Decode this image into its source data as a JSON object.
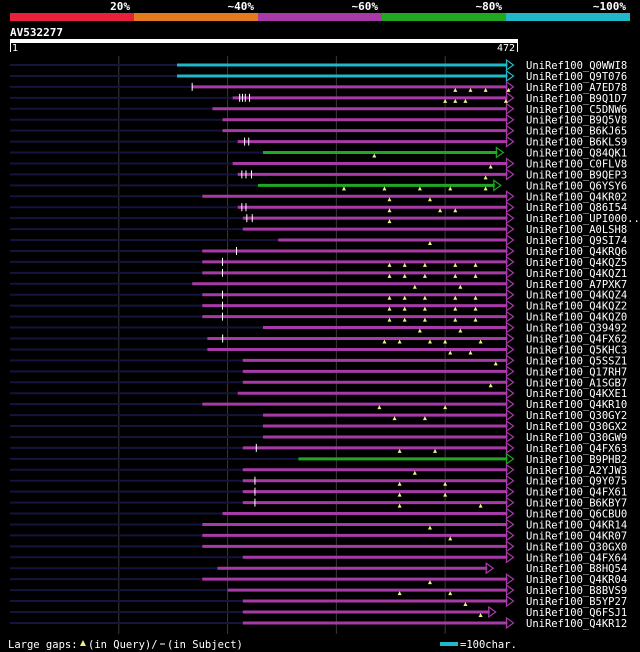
{
  "chart_data": {
    "type": "alignment-overview",
    "query": {
      "name": "AV532277",
      "start": "1",
      "end": "472"
    },
    "identity_legend": [
      {
        "label": "20%",
        "color": "#e8213a"
      },
      {
        "label": "~40%",
        "color": "#e87a1e"
      },
      {
        "label": "~60%",
        "color": "#a83aa8"
      },
      {
        "label": "~80%",
        "color": "#20a820"
      },
      {
        "label": "~100%",
        "color": "#20b8c8"
      }
    ],
    "hits": [
      {
        "name": "UniRef100_Q0WWI8",
        "from": 0.08,
        "to": 0.995,
        "identity": "~100%",
        "inserts": [],
        "gaps": []
      },
      {
        "name": "UniRef100_Q9T076",
        "from": 0.08,
        "to": 0.995,
        "identity": "~100%",
        "inserts": [],
        "gaps": []
      },
      {
        "name": "UniRef100_A7ED78",
        "from": 0.0,
        "to": 0.995,
        "identity": "~60%",
        "inserts": [
          0.88,
          0.91,
          0.94,
          0.985
        ],
        "gaps": [
          0.0
        ]
      },
      {
        "name": "UniRef100_B9Q1D7",
        "from": 0.0,
        "to": 0.995,
        "identity": "~60%",
        "inserts": [
          0.86,
          0.88,
          0.9,
          0.98
        ],
        "gaps": [
          0.05,
          0.07,
          0.09,
          0.12
        ]
      },
      {
        "name": "UniRef100_C5DNW6",
        "from": 0.0,
        "to": 0.995,
        "identity": "~60%",
        "inserts": [],
        "gaps": []
      },
      {
        "name": "UniRef100_B9Q5V8",
        "from": 0.0,
        "to": 0.995,
        "identity": "~60%",
        "inserts": [],
        "gaps": []
      },
      {
        "name": "UniRef100_B6KJ65",
        "from": 0.0,
        "to": 0.995,
        "identity": "~60%",
        "inserts": [],
        "gaps": []
      },
      {
        "name": "UniRef100_B6KLS9",
        "from": 0.0,
        "to": 0.995,
        "identity": "~60%",
        "inserts": [],
        "gaps": [
          0.05,
          0.08
        ]
      },
      {
        "name": "UniRef100_Q84QK1",
        "from": 0.0,
        "to": 0.975,
        "identity": "~80%",
        "inserts": [
          0.72
        ],
        "gaps": []
      },
      {
        "name": "UniRef100_C0FLV8",
        "from": 0.0,
        "to": 0.995,
        "identity": "~60%",
        "inserts": [
          0.95
        ],
        "gaps": []
      },
      {
        "name": "UniRef100_B9QEP3",
        "from": 0.0,
        "to": 0.995,
        "identity": "~60%",
        "inserts": [
          0.94
        ],
        "gaps": [
          0.03,
          0.06,
          0.1
        ]
      },
      {
        "name": "UniRef100_Q6YSY6",
        "from": 0.0,
        "to": 0.97,
        "identity": "~80%",
        "inserts": [
          0.66,
          0.74,
          0.81,
          0.87,
          0.94
        ],
        "gaps": []
      },
      {
        "name": "UniRef100_Q4KR02",
        "from": 0.0,
        "to": 0.995,
        "identity": "~60%",
        "inserts": [
          0.75,
          0.83
        ],
        "gaps": []
      },
      {
        "name": "UniRef100_Q86I54",
        "from": 0.0,
        "to": 0.995,
        "identity": "~60%",
        "inserts": [
          0.75,
          0.85,
          0.88
        ],
        "gaps": [
          0.03,
          0.06
        ]
      },
      {
        "name": "UniRef100_UPI000..",
        "from": 0.0,
        "to": 0.995,
        "identity": "~60%",
        "inserts": [
          0.75
        ],
        "gaps": [
          0.03,
          0.07
        ]
      },
      {
        "name": "UniRef100_A0LSH8",
        "from": 0.0,
        "to": 0.995,
        "identity": "~60%",
        "inserts": [],
        "gaps": []
      },
      {
        "name": "UniRef100_Q9SI74",
        "from": 0.0,
        "to": 0.995,
        "identity": "~60%",
        "inserts": [
          0.83
        ],
        "gaps": []
      },
      {
        "name": "UniRef100_Q4KRQ6",
        "from": 0.0,
        "to": 0.995,
        "identity": "~60%",
        "inserts": [],
        "gaps": [
          0.22
        ]
      },
      {
        "name": "UniRef100_Q4KQZ5",
        "from": 0.0,
        "to": 0.995,
        "identity": "~60%",
        "inserts": [
          0.75,
          0.78,
          0.82,
          0.88,
          0.92
        ],
        "gaps": [
          0.13
        ]
      },
      {
        "name": "UniRef100_Q4KQZ1",
        "from": 0.0,
        "to": 0.995,
        "identity": "~60%",
        "inserts": [
          0.75,
          0.78,
          0.82,
          0.88,
          0.92
        ],
        "gaps": [
          0.13
        ]
      },
      {
        "name": "UniRef100_A7PXK7",
        "from": 0.0,
        "to": 0.995,
        "identity": "~60%",
        "inserts": [
          0.8,
          0.89
        ],
        "gaps": []
      },
      {
        "name": "UniRef100_Q4KQZ4",
        "from": 0.0,
        "to": 0.995,
        "identity": "~60%",
        "inserts": [
          0.75,
          0.78,
          0.82,
          0.88,
          0.92
        ],
        "gaps": [
          0.13
        ]
      },
      {
        "name": "UniRef100_Q4KQZ2",
        "from": 0.0,
        "to": 0.995,
        "identity": "~60%",
        "inserts": [
          0.75,
          0.78,
          0.82,
          0.88,
          0.92
        ],
        "gaps": [
          0.13
        ]
      },
      {
        "name": "UniRef100_Q4KQZ0",
        "from": 0.0,
        "to": 0.995,
        "identity": "~60%",
        "inserts": [
          0.75,
          0.78,
          0.82,
          0.88,
          0.92
        ],
        "gaps": [
          0.13
        ]
      },
      {
        "name": "UniRef100_Q39492",
        "from": 0.0,
        "to": 0.995,
        "identity": "~60%",
        "inserts": [
          0.81,
          0.89
        ],
        "gaps": []
      },
      {
        "name": "UniRef100_Q4FX62",
        "from": 0.0,
        "to": 0.995,
        "identity": "~60%",
        "inserts": [
          0.74,
          0.77,
          0.83,
          0.86,
          0.93
        ],
        "gaps": [
          0.1
        ]
      },
      {
        "name": "UniRef100_Q5KHC3",
        "from": 0.0,
        "to": 0.995,
        "identity": "~60%",
        "inserts": [
          0.87,
          0.91
        ],
        "gaps": []
      },
      {
        "name": "UniRef100_Q5SSZ1",
        "from": 0.0,
        "to": 0.995,
        "identity": "~60%",
        "inserts": [
          0.96
        ],
        "gaps": []
      },
      {
        "name": "UniRef100_Q17RH7",
        "from": 0.0,
        "to": 0.995,
        "identity": "~60%",
        "inserts": [],
        "gaps": []
      },
      {
        "name": "UniRef100_A1SGB7",
        "from": 0.0,
        "to": 0.995,
        "identity": "~60%",
        "inserts": [
          0.95
        ],
        "gaps": []
      },
      {
        "name": "UniRef100_Q4KXE1",
        "from": 0.0,
        "to": 0.995,
        "identity": "~60%",
        "inserts": [],
        "gaps": []
      },
      {
        "name": "UniRef100_Q4KR10",
        "from": 0.0,
        "to": 0.995,
        "identity": "~60%",
        "inserts": [
          0.73,
          0.86
        ],
        "gaps": []
      },
      {
        "name": "UniRef100_Q30GY2",
        "from": 0.0,
        "to": 0.995,
        "identity": "~60%",
        "inserts": [
          0.76,
          0.82
        ],
        "gaps": []
      },
      {
        "name": "UniRef100_Q30GX2",
        "from": 0.0,
        "to": 0.995,
        "identity": "~60%",
        "inserts": [],
        "gaps": []
      },
      {
        "name": "UniRef100_Q30GW9",
        "from": 0.0,
        "to": 0.995,
        "identity": "~60%",
        "inserts": [],
        "gaps": []
      },
      {
        "name": "UniRef100_Q4FX63",
        "from": 0.0,
        "to": 0.995,
        "identity": "~60%",
        "inserts": [
          0.77,
          0.84
        ],
        "gaps": [
          0.1
        ]
      },
      {
        "name": "UniRef100_B9PHB2",
        "from": 0.0,
        "to": 0.995,
        "identity": "~80%",
        "inserts": [],
        "gaps": []
      },
      {
        "name": "UniRef100_A2YJW3",
        "from": 0.0,
        "to": 0.995,
        "identity": "~60%",
        "inserts": [
          0.8
        ],
        "gaps": []
      },
      {
        "name": "UniRef100_Q9Y075",
        "from": 0.0,
        "to": 0.995,
        "identity": "~60%",
        "inserts": [
          0.77,
          0.86
        ],
        "gaps": [
          0.09
        ]
      },
      {
        "name": "UniRef100_Q4FX61",
        "from": 0.0,
        "to": 0.995,
        "identity": "~60%",
        "inserts": [
          0.77,
          0.86
        ],
        "gaps": [
          0.09
        ]
      },
      {
        "name": "UniRef100_B6KBY7",
        "from": 0.0,
        "to": 0.995,
        "identity": "~60%",
        "inserts": [
          0.77,
          0.93
        ],
        "gaps": [
          0.09
        ]
      },
      {
        "name": "UniRef100_Q6CBU0",
        "from": 0.0,
        "to": 0.995,
        "identity": "~60%",
        "inserts": [],
        "gaps": []
      },
      {
        "name": "UniRef100_Q4KR14",
        "from": 0.0,
        "to": 0.995,
        "identity": "~60%",
        "inserts": [
          0.83
        ],
        "gaps": []
      },
      {
        "name": "UniRef100_Q4KR07",
        "from": 0.0,
        "to": 0.995,
        "identity": "~60%",
        "inserts": [
          0.87
        ],
        "gaps": []
      },
      {
        "name": "UniRef100_Q30GX0",
        "from": 0.0,
        "to": 0.995,
        "identity": "~60%",
        "inserts": [],
        "gaps": []
      },
      {
        "name": "UniRef100_Q4FX64",
        "from": 0.0,
        "to": 0.995,
        "identity": "~60%",
        "inserts": [],
        "gaps": []
      },
      {
        "name": "UniRef100_B8HQ54",
        "from": 0.0,
        "to": 0.955,
        "identity": "~60%",
        "inserts": [],
        "gaps": []
      },
      {
        "name": "UniRef100_Q4KR04",
        "from": 0.0,
        "to": 0.995,
        "identity": "~60%",
        "inserts": [
          0.83
        ],
        "gaps": []
      },
      {
        "name": "UniRef100_B8BVS9",
        "from": 0.0,
        "to": 0.995,
        "identity": "~60%",
        "inserts": [
          0.77,
          0.87
        ],
        "gaps": []
      },
      {
        "name": "UniRef100_B5YP27",
        "from": 0.0,
        "to": 0.995,
        "identity": "~60%",
        "inserts": [
          0.9
        ],
        "gaps": []
      },
      {
        "name": "UniRef100_Q6FSJ1",
        "from": 0.0,
        "to": 0.96,
        "identity": "~60%",
        "inserts": [
          0.93
        ],
        "gaps": []
      },
      {
        "name": "UniRef100_Q4KR12",
        "from": 0.0,
        "to": 0.995,
        "identity": "~60%",
        "inserts": [],
        "gaps": []
      }
    ],
    "footer": {
      "gaps_label": "Large gaps:",
      "in_query_label": "(in Query)/",
      "in_subject_label": "(in Subject)",
      "scale_label": "=100char.",
      "scale_color": "#20b8c8"
    }
  }
}
